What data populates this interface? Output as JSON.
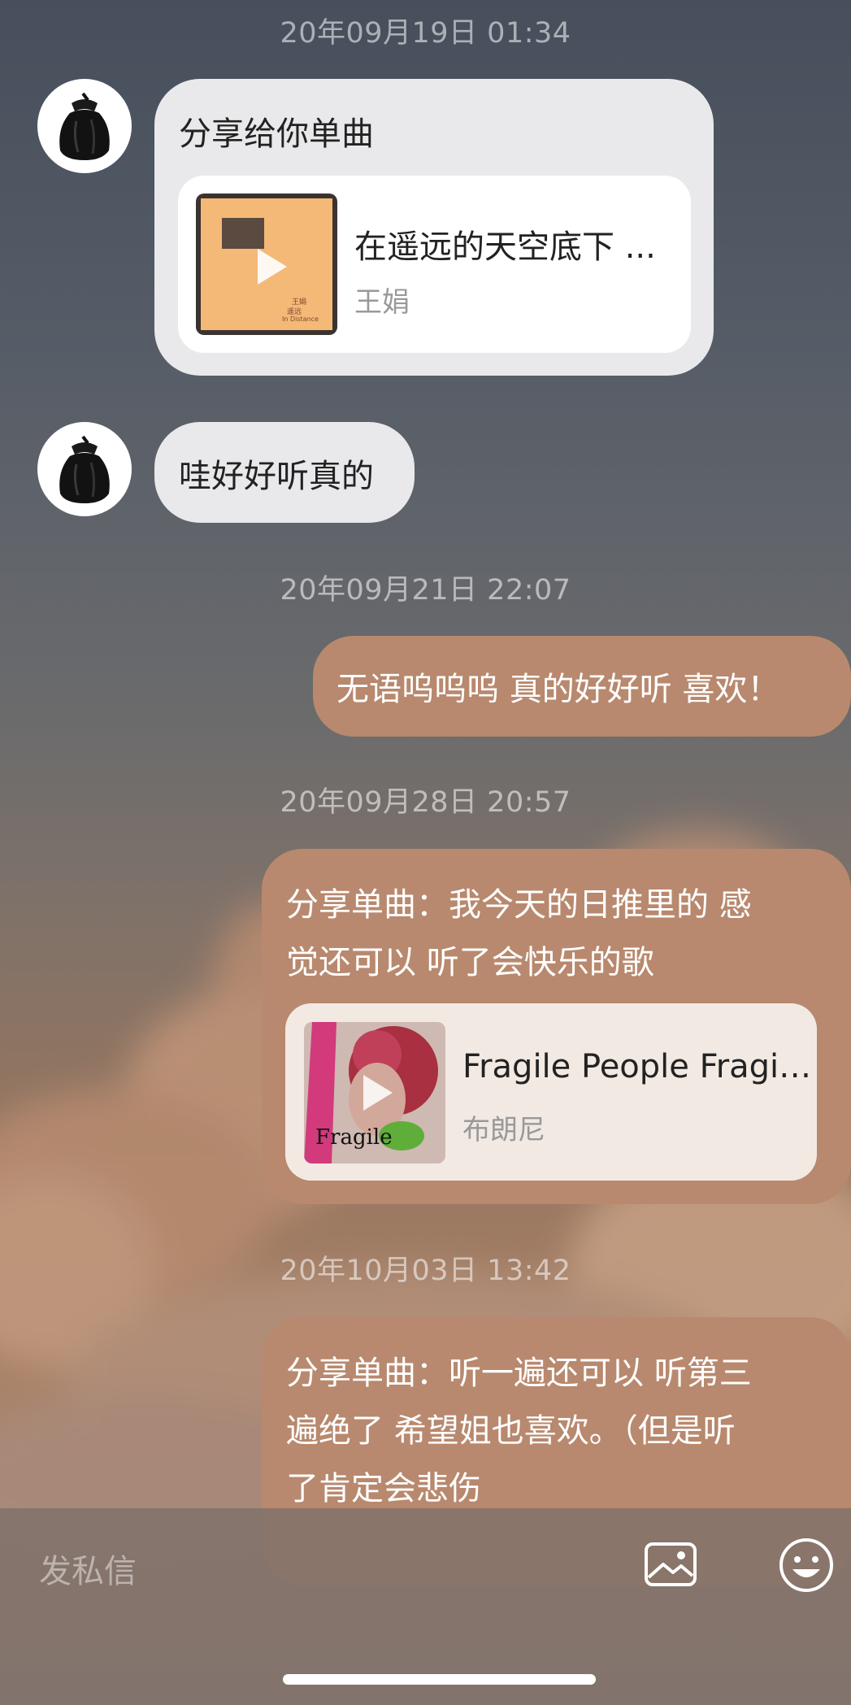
{
  "timestamps": [
    "20年09月19日 01:34",
    "20年09月21日 22:07",
    "20年09月28日 20:57",
    "20年10月03日 13:42"
  ],
  "messages": {
    "m1_text": "分享给你单曲",
    "m1_song_title": "在遥远的天空底下 ...",
    "m1_song_artist": "王娟",
    "m2_text": "哇好好听真的",
    "m3_text": "无语呜呜呜 真的好好听 喜欢！",
    "m4_line1": "分享单曲：我今天的日推里的 感",
    "m4_line2": "觉还可以 听了会快乐的歌",
    "m4_song_title": "Fragile People Fragil...",
    "m4_song_artist": "布朗尼",
    "m5_line1": "分享单曲：听一遍还可以 听第三",
    "m5_line2": "遍绝了 希望姐也喜欢。（但是听",
    "m5_line3": "了肯定会悲伤"
  },
  "covers": {
    "c1_small_text1": "王娟",
    "c1_small_text2": "遥远",
    "c1_small_text3": "In Distance",
    "c2_script": "Fragile"
  },
  "input": {
    "placeholder": "发私信"
  },
  "colors": {
    "incoming_bubble": "#e9e9eb",
    "outgoing_bubble": "#b8896e",
    "card_out": "#f2e9e3"
  },
  "icons": [
    "image-icon",
    "emoji-icon",
    "play-icon"
  ]
}
